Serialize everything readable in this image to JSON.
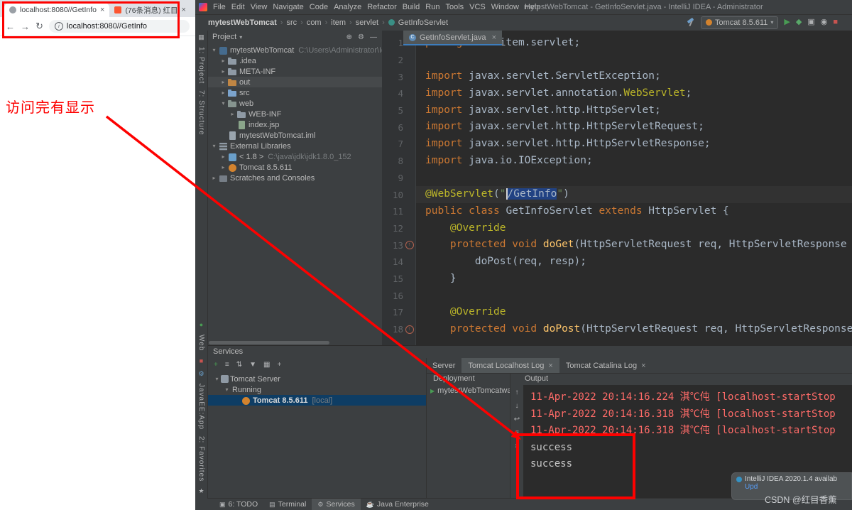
{
  "annotation": {
    "note": "访问完有显示",
    "color": "#fd0100"
  },
  "browser": {
    "tabs": [
      {
        "title": "localhost:8080//GetInfo"
      },
      {
        "title": "(76条消息) 红目"
      }
    ],
    "nav_icons": [
      {
        "name": "back-icon",
        "glyph": "←"
      },
      {
        "name": "forward-icon",
        "glyph": "→"
      },
      {
        "name": "refresh-icon",
        "glyph": "↻"
      }
    ],
    "url": "localhost:8080//GetInfo"
  },
  "ide": {
    "title_bar": {
      "menus": [
        "File",
        "Edit",
        "View",
        "Navigate",
        "Code",
        "Analyze",
        "Refactor",
        "Build",
        "Run",
        "Tools",
        "VCS",
        "Window",
        "Help"
      ],
      "title": "mytestWebTomcat - GetInfoServlet.java - IntelliJ IDEA - Administrator"
    },
    "toolbar": {
      "breadcrumbs": [
        "mytestWebTomcat",
        "src",
        "com",
        "item",
        "servlet",
        "GetInfoServlet"
      ],
      "run_config": "Tomcat 8.5.611",
      "actions": [
        {
          "name": "run-icon",
          "glyph": "▶",
          "color": "#499c54"
        },
        {
          "name": "debug-icon",
          "glyph": "◆",
          "color": "#59a869"
        },
        {
          "name": "coverage-icon",
          "glyph": "▣",
          "color": "#afb1b3"
        },
        {
          "name": "profiler-icon",
          "glyph": "◉",
          "color": "#afb1b3"
        },
        {
          "name": "stop-icon",
          "glyph": "■",
          "color": "#c75450"
        }
      ]
    },
    "tool_strip": {
      "items": [
        {
          "kind": "icon",
          "name": "grid-icon",
          "glyph": "▦",
          "color": "#afb1b3"
        },
        {
          "kind": "label",
          "name": "tool-window-project",
          "label": "1: Project"
        },
        {
          "kind": "label",
          "name": "tool-window-structure",
          "label": "7: Structure"
        },
        {
          "kind": "spacer"
        },
        {
          "kind": "icon",
          "name": "web-run-icon",
          "glyph": "●",
          "color": "#499c54"
        },
        {
          "kind": "label",
          "name": "tool-window-web",
          "label": "Web"
        },
        {
          "kind": "icon",
          "name": "stop-icon",
          "glyph": "■",
          "color": "#c75450"
        },
        {
          "kind": "icon",
          "name": "settings-icon",
          "glyph": "⚙",
          "color": "#6a9fca"
        },
        {
          "kind": "label",
          "name": "tool-window-javaee-app",
          "label": "JavaEE:App"
        },
        {
          "kind": "label",
          "name": "tool-window-favorites",
          "label": "2: Favorites"
        },
        {
          "kind": "icon",
          "name": "star-icon",
          "glyph": "★",
          "color": "#afb1b3"
        }
      ]
    },
    "project_panel": {
      "header": "Project",
      "tree": [
        {
          "label": "mytestWebTomcat",
          "hint": "C:\\Users\\Administrator\\IdeaP",
          "indent": 0,
          "arrow": "▾",
          "icon": "project"
        },
        {
          "label": ".idea",
          "indent": 1,
          "arrow": "▸",
          "icon": "folder"
        },
        {
          "label": "META-INF",
          "indent": 1,
          "arrow": "▸",
          "icon": "folder"
        },
        {
          "label": "out",
          "indent": 1,
          "arrow": "▸",
          "icon": "folder-excluded",
          "selected": true
        },
        {
          "label": "src",
          "indent": 1,
          "arrow": "▸",
          "icon": "folder-src"
        },
        {
          "label": "web",
          "indent": 1,
          "arrow": "▾",
          "icon": "folder-web"
        },
        {
          "label": "WEB-INF",
          "indent": 2,
          "arrow": "▸",
          "icon": "folder"
        },
        {
          "label": "index.jsp",
          "indent": 2,
          "arrow": "",
          "icon": "file-jsp"
        },
        {
          "label": "mytestWebTomcat.iml",
          "indent": 1,
          "arrow": "",
          "icon": "file"
        },
        {
          "label": "External Libraries",
          "indent": 0,
          "arrow": "▾",
          "icon": "libraries"
        },
        {
          "label": "< 1.8 >",
          "hint": "C:\\java\\jdk\\jdk1.8.0_152",
          "indent": 1,
          "arrow": "▸",
          "icon": "jdk"
        },
        {
          "label": "Tomcat 8.5.611",
          "indent": 1,
          "arrow": "▸",
          "icon": "tomcat"
        },
        {
          "label": "Scratches and Consoles",
          "indent": 0,
          "arrow": "▸",
          "icon": "scratches"
        }
      ]
    },
    "editor": {
      "tab": "GetInfoServlet.java",
      "lines": [
        {
          "n": 1,
          "segs": [
            [
              "kw",
              "package "
            ],
            [
              "pl",
              "com.item.servlet;"
            ]
          ]
        },
        {
          "n": 2,
          "segs": []
        },
        {
          "n": 3,
          "segs": [
            [
              "kw",
              "import "
            ],
            [
              "pl",
              "javax.servlet.ServletException;"
            ]
          ]
        },
        {
          "n": 4,
          "segs": [
            [
              "kw",
              "import "
            ],
            [
              "pl",
              "javax.servlet.annotation."
            ],
            [
              "ann",
              "WebServlet"
            ],
            [
              "pl",
              ";"
            ]
          ]
        },
        {
          "n": 5,
          "segs": [
            [
              "kw",
              "import "
            ],
            [
              "pl",
              "javax.servlet.http.HttpServlet;"
            ]
          ]
        },
        {
          "n": 6,
          "segs": [
            [
              "kw",
              "import "
            ],
            [
              "pl",
              "javax.servlet.http.HttpServletRequest;"
            ]
          ]
        },
        {
          "n": 7,
          "segs": [
            [
              "kw",
              "import "
            ],
            [
              "pl",
              "javax.servlet.http.HttpServletResponse;"
            ]
          ]
        },
        {
          "n": 8,
          "segs": [
            [
              "kw",
              "import "
            ],
            [
              "pl",
              "java.io.IOException;"
            ]
          ]
        },
        {
          "n": 9,
          "segs": []
        },
        {
          "n": 10,
          "caret_line": true,
          "segs": [
            [
              "ann",
              "@WebServlet"
            ],
            [
              "pl",
              "("
            ],
            [
              "str",
              "\""
            ],
            [
              "caret",
              ""
            ],
            [
              "sel",
              "/GetInfo"
            ],
            [
              "str",
              "\""
            ],
            [
              "pl",
              ")"
            ]
          ]
        },
        {
          "n": 11,
          "segs": [
            [
              "kw",
              "public class "
            ],
            [
              "pl",
              "GetInfoServlet "
            ],
            [
              "kw",
              "extends "
            ],
            [
              "pl",
              "HttpServlet {"
            ]
          ]
        },
        {
          "n": 12,
          "segs": [
            [
              "pl",
              "    "
            ],
            [
              "ann",
              "@Override"
            ]
          ]
        },
        {
          "n": 13,
          "mark": "override",
          "segs": [
            [
              "pl",
              "    "
            ],
            [
              "kw",
              "protected void "
            ],
            [
              "fn",
              "doGet"
            ],
            [
              "pl",
              "(HttpServletRequest req, HttpServletResponse"
            ]
          ]
        },
        {
          "n": 14,
          "segs": [
            [
              "pl",
              "        doPost(req, resp);"
            ]
          ]
        },
        {
          "n": 15,
          "segs": [
            [
              "pl",
              "    }"
            ]
          ]
        },
        {
          "n": 16,
          "segs": []
        },
        {
          "n": 17,
          "segs": [
            [
              "pl",
              "    "
            ],
            [
              "ann",
              "@Override"
            ]
          ]
        },
        {
          "n": 18,
          "mark": "override",
          "segs": [
            [
              "pl",
              "    "
            ],
            [
              "kw",
              "protected void "
            ],
            [
              "fn",
              "doPost"
            ],
            [
              "pl",
              "(HttpServletRequest req, HttpServletResponse"
            ]
          ]
        }
      ]
    },
    "services": {
      "panel_title": "Services",
      "toolbar": [
        {
          "name": "add-service-icon",
          "glyph": "+",
          "color": "#499c54"
        },
        {
          "name": "view-options-icon",
          "glyph": "≡",
          "color": "#afb1b3"
        },
        {
          "name": "expand-collapse-icon",
          "glyph": "⇅",
          "color": "#afb1b3"
        },
        {
          "name": "filter-icon",
          "glyph": "▼",
          "color": "#afb1b3"
        },
        {
          "name": "group-icon",
          "glyph": "▦",
          "color": "#afb1b3"
        },
        {
          "name": "add-icon",
          "glyph": "+",
          "color": "#afb1b3"
        }
      ],
      "tree": [
        {
          "label": "Tomcat Server",
          "indent": 0,
          "arrow": "▾",
          "icon": "server"
        },
        {
          "label": "Running",
          "indent": 1,
          "arrow": "▾",
          "icon": "none"
        },
        {
          "label": "Tomcat 8.5.611",
          "suffix": "[local]",
          "indent": 2,
          "arrow": "",
          "icon": "tomcat",
          "selected": true
        }
      ],
      "tabs": [
        {
          "label": "Server"
        },
        {
          "label": "Tomcat Localhost Log",
          "closable": true,
          "active": true
        },
        {
          "label": "Tomcat Catalina Log",
          "closable": true
        }
      ],
      "deployment": {
        "header": "Deployment",
        "items": [
          "mytestWebTomcatwar"
        ]
      },
      "output": {
        "header": "Output",
        "toolbar": [
          {
            "name": "scroll-up-icon",
            "glyph": "↑"
          },
          {
            "name": "scroll-down-icon",
            "glyph": "↓"
          },
          {
            "name": "soft-wrap-icon",
            "glyph": "↩"
          },
          {
            "name": "scroll-to-end-icon",
            "glyph": "≡"
          },
          {
            "name": "clear-icon",
            "glyph": "×"
          }
        ],
        "lines": [
          {
            "type": "error",
            "text": "11-Apr-2022 20:14:16.224 淇℃伅 [localhost-startStop"
          },
          {
            "type": "error",
            "text": "11-Apr-2022 20:14:16.318 淇℃伅 [localhost-startStop"
          },
          {
            "type": "error",
            "text": "11-Apr-2022 20:14:16.318 淇℃伅 [localhost-startStop"
          },
          {
            "type": "plain",
            "text": "success"
          },
          {
            "type": "plain",
            "text": "success"
          }
        ]
      }
    },
    "status_bar": {
      "items": [
        {
          "label": "6: TODO",
          "icon": "todo-icon",
          "glyph": "▣"
        },
        {
          "label": "Terminal",
          "icon": "terminal-icon",
          "glyph": "▤"
        },
        {
          "label": "Services",
          "icon": "services-icon",
          "glyph": "⚙",
          "active": true
        },
        {
          "label": "Java Enterprise",
          "icon": "java-enterprise-icon",
          "glyph": "☕"
        }
      ]
    },
    "notification": {
      "text": "IntelliJ IDEA 2020.1.4 availab",
      "link": "Upd"
    },
    "watermark": "CSDN @红目香薰"
  }
}
